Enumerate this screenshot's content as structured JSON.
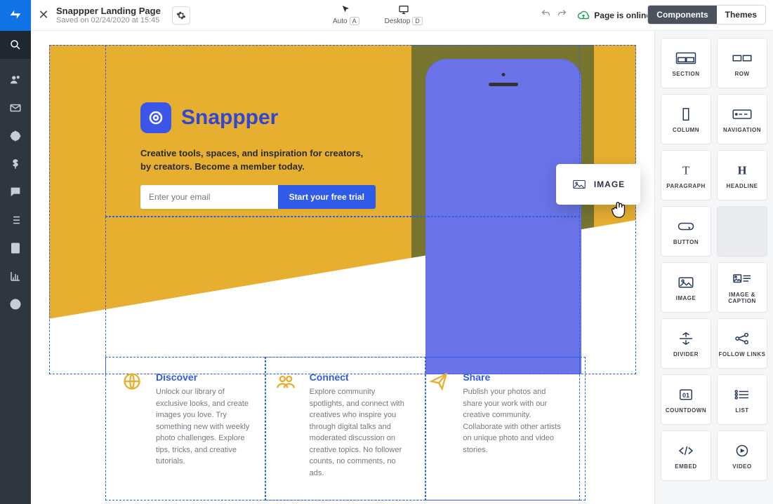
{
  "page": {
    "title": "Snappper Landing Page",
    "saved": "Saved on 02/24/2020 at 15:45"
  },
  "tools": {
    "auto": {
      "label": "Auto",
      "key": "A"
    },
    "desktop": {
      "label": "Desktop",
      "key": "D"
    }
  },
  "status": {
    "cloud": "Page is online"
  },
  "tabs": {
    "components": "Components",
    "themes": "Themes"
  },
  "components": [
    {
      "id": "section",
      "label": "SECTION"
    },
    {
      "id": "row",
      "label": "ROW"
    },
    {
      "id": "column",
      "label": "COLUMN"
    },
    {
      "id": "navigation",
      "label": "NAVIGATION"
    },
    {
      "id": "paragraph",
      "label": "PARAGRAPH"
    },
    {
      "id": "headline",
      "label": "HEADLINE"
    },
    {
      "id": "button",
      "label": "BUTTON"
    },
    {
      "id": "placeholder",
      "label": ""
    },
    {
      "id": "image",
      "label": "IMAGE"
    },
    {
      "id": "image_caption",
      "label": "IMAGE & CAPTION"
    },
    {
      "id": "divider",
      "label": "DIVIDER"
    },
    {
      "id": "follow_links",
      "label": "FOLLOW LINKS"
    },
    {
      "id": "countdown",
      "label": "COUNTDOWN"
    },
    {
      "id": "list",
      "label": "LIST"
    },
    {
      "id": "embed",
      "label": "EMBED"
    },
    {
      "id": "video",
      "label": "VIDEO"
    }
  ],
  "dragging": {
    "label": "IMAGE"
  },
  "canvas": {
    "brand": "Snappper",
    "tagline": "Creative tools, spaces, and inspiration for creators, by creators. Become a member today.",
    "email_placeholder": "Enter your email",
    "cta": "Start your free trial",
    "features": [
      {
        "title": "Discover",
        "body": "Unlock our library of exclusive looks, and create images you love. Try something new with weekly photo challenges. Explore tips, tricks, and creative tutorials."
      },
      {
        "title": "Connect",
        "body": "Explore community spotlights, and connect with creatives who inspire you through digital talks and moderated discussion on creative topics. No follower counts, no comments, no ads."
      },
      {
        "title": "Share",
        "body": "Publish your photos and share your work with our creative community. Collaborate with other artists on unique photo and video stories."
      }
    ]
  }
}
